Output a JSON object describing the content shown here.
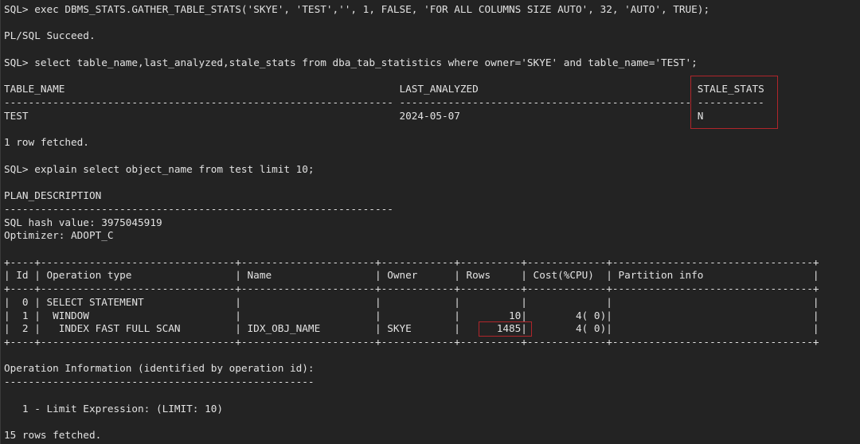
{
  "terminal": {
    "prompt": "SQL> ",
    "commands": {
      "gather_stats": "exec DBMS_STATS.GATHER_TABLE_STATS('SKYE', 'TEST','', 1, FALSE, 'FOR ALL COLUMNS SIZE AUTO', 32, 'AUTO', TRUE);",
      "select_stats": "select table_name,last_analyzed,stale_stats from dba_tab_statistics where owner='SKYE' and table_name='TEST';",
      "explain": "explain select object_name from test limit 10;"
    },
    "gather_result": "PL/SQL Succeed.",
    "stats_query": {
      "columns": [
        {
          "name": "TABLE_NAME",
          "width": 64
        },
        {
          "name": "LAST_ANALYZED",
          "width": 48
        },
        {
          "name": "STALE_STATS",
          "width": 11
        }
      ],
      "rows": [
        [
          "TEST",
          "2024-05-07",
          "N"
        ]
      ],
      "footer": "1 row fetched."
    },
    "plan": {
      "header": "PLAN_DESCRIPTION",
      "header_rule_length": 64,
      "hash_line": "SQL hash value: 3975045919",
      "optimizer_line": "Optimizer: ADOPT_C",
      "table": {
        "columns": [
          "Id",
          "Operation type",
          "Name",
          "Owner",
          "Rows",
          "Cost(%CPU)",
          "Partition info"
        ],
        "rows": [
          {
            "id": "0",
            "operation": "SELECT STATEMENT",
            "depth": 0,
            "name": "",
            "owner": "",
            "rows": "",
            "cost": "",
            "partition": ""
          },
          {
            "id": "1",
            "operation": "WINDOW",
            "depth": 1,
            "name": "",
            "owner": "",
            "rows": "10",
            "cost": "4( 0)",
            "partition": ""
          },
          {
            "id": "2",
            "operation": "INDEX FAST FULL SCAN",
            "depth": 2,
            "name": "IDX_OBJ_NAME",
            "owner": "SKYE",
            "rows": "1485",
            "cost": "4( 0)",
            "partition": ""
          }
        ]
      },
      "operation_info_header": "Operation Information (identified by operation id):",
      "operation_info": [
        "   1 - Limit Expression: (LIMIT: 10)"
      ],
      "footer": "15 rows fetched."
    },
    "highlight_color": "#b0262b"
  }
}
